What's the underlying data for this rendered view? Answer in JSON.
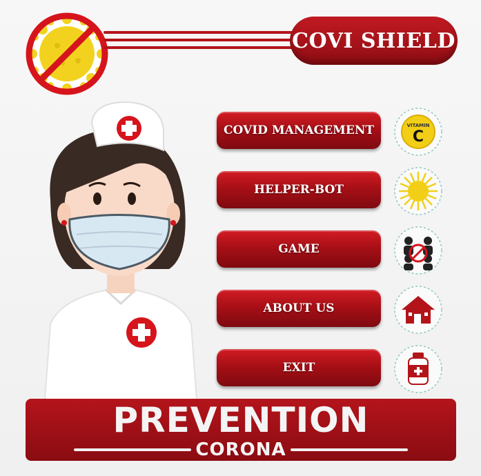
{
  "app": {
    "title": "COVI SHIELD"
  },
  "menu": {
    "items": [
      {
        "label": "COVID MANAGEMENT",
        "icon": "vitamin-c-icon"
      },
      {
        "label": "HELPER-BOT",
        "icon": "sun-icon"
      },
      {
        "label": "GAME",
        "icon": "people-no-contact-icon"
      },
      {
        "label": "ABOUT US",
        "icon": "house-icon"
      },
      {
        "label": "EXIT",
        "icon": "medicine-bottle-icon"
      }
    ]
  },
  "vitamin_icon": {
    "word": "VITAMIN",
    "letter": "C"
  },
  "footer": {
    "title": "PREVENTION",
    "subtitle": "CORONA"
  },
  "colors": {
    "brand_red": "#b3141a",
    "dark_red": "#8e0d13",
    "background": "#f2f2f2",
    "virus_yellow": "#f2d21f"
  }
}
